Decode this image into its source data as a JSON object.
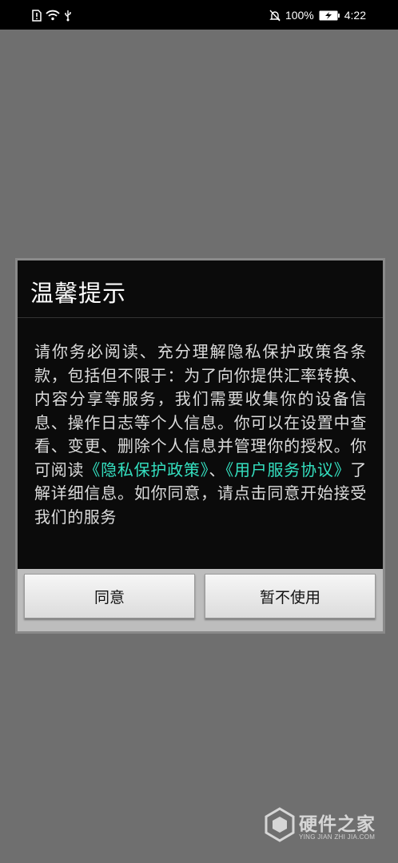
{
  "status_bar": {
    "battery_percent": "100%",
    "time": "4:22"
  },
  "dialog": {
    "title": "温馨提示",
    "body_part1": "请你务必阅读、充分理解隐私保护政策各条款，包括但不限于：为了向你提供汇率转换、内容分享等服务，我们需要收集你的设备信息、操作日志等个人信息。你可以在设置中查看、变更、删除个人信息并管理你的授权。你可阅读",
    "privacy_link": "《隐私保护政策》",
    "separator": "、",
    "service_link": "《用户服务协议》",
    "body_part2": "了解详细信息。如你同意，请点击同意开始接受我们的服务",
    "agree_button": "同意",
    "decline_button": "暂不使用",
    "link_color": "#34e0c0"
  },
  "watermark": {
    "name": "硬件之家",
    "domain": "YING JIAN ZHI JIA.COM"
  }
}
